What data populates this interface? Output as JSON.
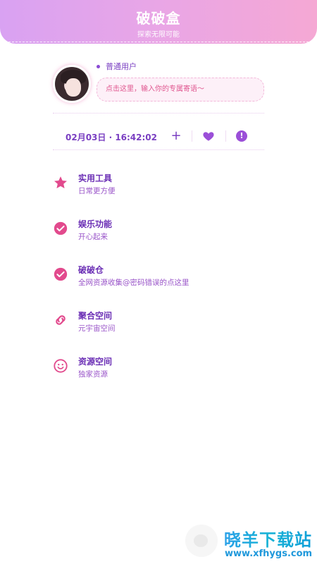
{
  "header": {
    "title": "破破盒",
    "subtitle": "探索无限可能"
  },
  "profile": {
    "user_type": "普通用户",
    "motto_placeholder": "点击这里，输入你的专属寄语～"
  },
  "status": {
    "datetime": "02月03日 · 16:42:02",
    "plus_icon": "plus-icon",
    "heart_icon": "heart-icon",
    "alert_icon": "alert-icon",
    "alert_glyph": "!"
  },
  "menu": {
    "items": [
      {
        "icon": "star-icon",
        "title": "实用工具",
        "subtitle": "日常更方便"
      },
      {
        "icon": "check-circle-icon",
        "title": "娱乐功能",
        "subtitle": "开心起来"
      },
      {
        "icon": "check-circle-icon",
        "title": "破破仓",
        "subtitle": "全网资源收集@密码错误的点这里"
      },
      {
        "icon": "link-icon",
        "title": "聚合空间",
        "subtitle": "元宇宙空间"
      },
      {
        "icon": "smile-icon",
        "title": "资源空间",
        "subtitle": "独家资源"
      }
    ]
  },
  "watermark": {
    "name": "晓羊下载站",
    "url": "www.xfhygs.com"
  },
  "colors": {
    "header_gradient": [
      "#d9a2f2",
      "#f5a8d4"
    ],
    "accent_purple": "#7a3fc2",
    "accent_pink": "#e0568f",
    "menu_icon_pink": "#e24a8d"
  }
}
